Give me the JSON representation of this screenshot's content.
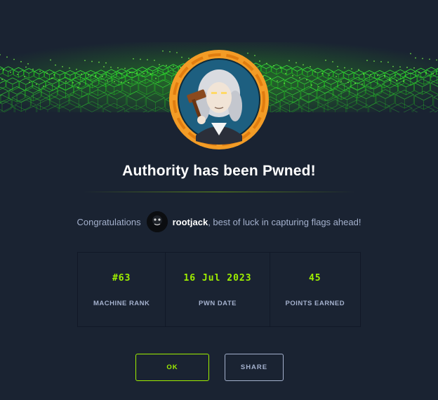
{
  "dialog": {
    "title": "Authority has been Pwned!",
    "congrats_prefix": "Congratulations",
    "username": "rootjack",
    "congrats_suffix": ", best of luck in capturing flags ahead!"
  },
  "stats": [
    {
      "value": "#63",
      "label": "MACHINE RANK"
    },
    {
      "value": "16 Jul 2023",
      "label": "PWN DATE"
    },
    {
      "value": "45",
      "label": "POINTS EARNED"
    }
  ],
  "buttons": {
    "ok_label": "OK",
    "share_label": "SHARE"
  },
  "icons": {
    "banner": "green-cube-grid-banner",
    "machine_avatar": "judge-with-gavel-avatar",
    "user_avatar": "black-avatar"
  },
  "colors": {
    "background": "#1a2332",
    "accent": "#9fef00",
    "avatar_ring": "#f39c26",
    "muted_text": "#a4b1cd"
  }
}
